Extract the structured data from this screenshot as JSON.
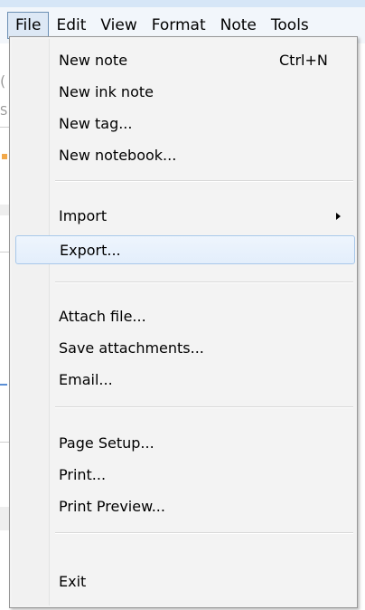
{
  "menubar": {
    "items": [
      {
        "label": "File"
      },
      {
        "label": "Edit"
      },
      {
        "label": "View"
      },
      {
        "label": "Format"
      },
      {
        "label": "Note"
      },
      {
        "label": "Tools"
      }
    ]
  },
  "background": {
    "glyph_a": "(",
    "glyph_b": "S"
  },
  "file_menu": {
    "new_note": "New note",
    "new_note_shortcut": "Ctrl+N",
    "new_ink_note": "New ink note",
    "new_tag": "New tag...",
    "new_notebook": "New notebook...",
    "import": "Import",
    "export": "Export...",
    "attach_file": "Attach file...",
    "save_attachments": "Save attachments...",
    "email": "Email...",
    "page_setup": "Page Setup...",
    "print": "Print...",
    "print_preview": "Print Preview...",
    "exit": "Exit"
  }
}
